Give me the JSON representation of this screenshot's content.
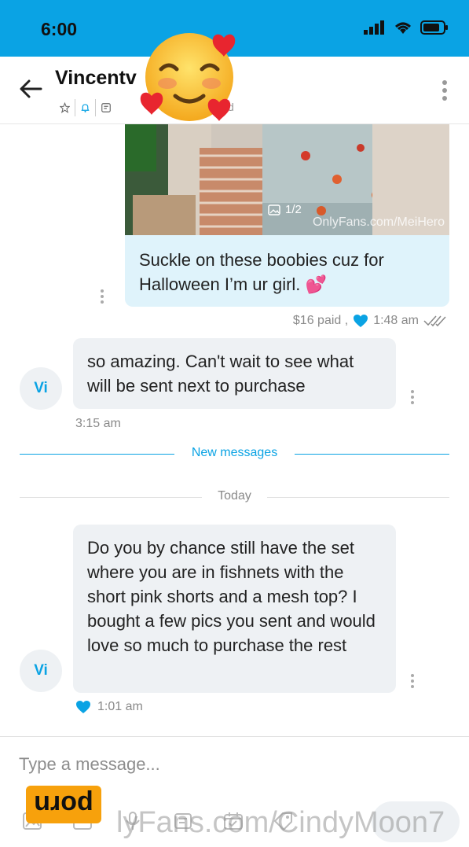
{
  "status": {
    "time": "6:00"
  },
  "header": {
    "title": "Vincentv",
    "sub_fragment": "d"
  },
  "photo": {
    "counter": "1/2",
    "watermark": "OnlyFans.com/MeiHero"
  },
  "messages": {
    "outgoing": {
      "text": "Suckle on these boobies cuz for Halloween I’m ur girl. 💕",
      "price": "$16 paid ,",
      "time": "1:48 am"
    },
    "incoming_1": {
      "avatar": "Vi",
      "text": "so amazing. Can't wait to see what will be sent next to purchase",
      "time": "3:15 am"
    },
    "incoming_2": {
      "avatar": "Vi",
      "text": "Do you by chance still have the set where you are in fishnets with the short pink shorts and a mesh top? I bought a few pics you sent and would love so much to purchase the rest",
      "time": "1:01 am"
    }
  },
  "dividers": {
    "new_messages": "New messages",
    "today": "Today"
  },
  "composer": {
    "placeholder": "Type a message..."
  },
  "overlay": {
    "logo": "porn",
    "watermark": "lyFans.com/CindyMoon7"
  },
  "colors": {
    "accent": "#0aa3e4",
    "bubble_out": "#dff3fb",
    "bubble_in": "#eef1f4"
  },
  "icons": {
    "emoji_sticker": "smiling-face-with-hearts-icon",
    "heart": "heart-icon",
    "read": "double-check-icon"
  }
}
